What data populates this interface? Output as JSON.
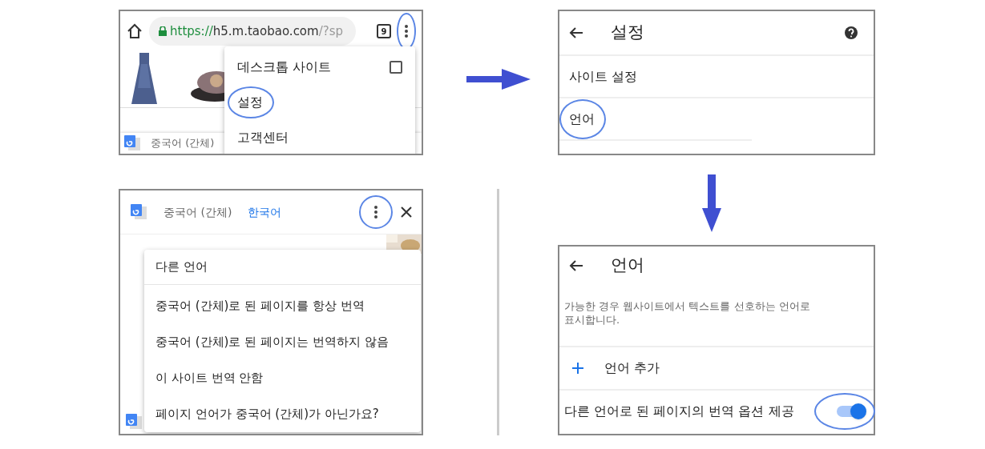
{
  "browser_panel": {
    "url_scheme": "https://",
    "url_host": "h5.m.taobao.com",
    "url_path": "/?sp",
    "tab_count": "9",
    "more_highlighted": true,
    "menu": [
      {
        "label": "데스크톱 사이트",
        "kind": "checkbox",
        "checked": false,
        "highlighted": false
      },
      {
        "label": "설정",
        "kind": "plain",
        "highlighted": true
      },
      {
        "label": "고객센터",
        "kind": "plain",
        "highlighted": false
      }
    ],
    "translate_bar": {
      "source_language": "중국어 (간체)"
    }
  },
  "settings_panel": {
    "title": "설정",
    "items": [
      {
        "label": "사이트 설정",
        "highlighted": false
      },
      {
        "label": "언어",
        "highlighted": true
      }
    ]
  },
  "translate_panel": {
    "languages": [
      {
        "label": "중국어 (간체)",
        "selected": false
      },
      {
        "label": "한국어",
        "selected": true
      }
    ],
    "more_highlighted": true,
    "menu_header": "다른 언어",
    "menu": [
      "중국어 (간체)로 된 페이지를 항상 번역",
      "중국어 (간체)로 된 페이지는 번역하지 않음",
      "이 사이트 번역 안함",
      "페이지 언어가 중국어 (간체)가 아닌가요?"
    ]
  },
  "language_panel": {
    "title": "언어",
    "description": "가능한 경우 웹사이트에서 텍스트를 선호하는 언어로 표시합니다.",
    "add_label": "언어 추가",
    "toggle": {
      "label": "다른 언어로 된 페이지의 번역 옵션 제공",
      "on": true,
      "highlighted": true
    }
  }
}
